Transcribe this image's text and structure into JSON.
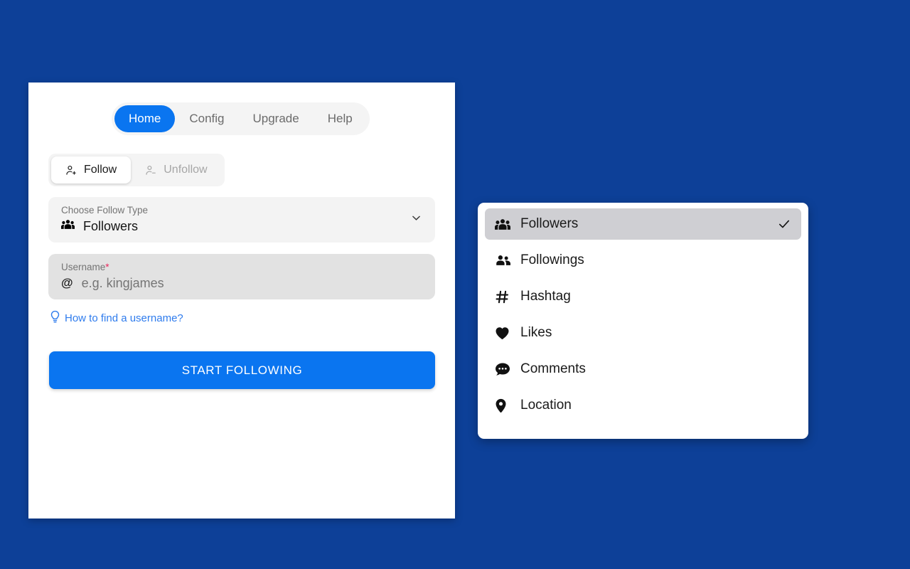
{
  "theme": {
    "background": "#0d4098",
    "accent": "#0a75f0",
    "panel": "#ffffff",
    "field_bg": "#f3f3f3",
    "field_bg_focus": "#e2e2e2",
    "selected_row": "#cfcfd3",
    "required_star": "#e8275c",
    "link": "#2f7ced"
  },
  "tabs": [
    {
      "label": "Home",
      "icon": "",
      "active": true
    },
    {
      "label": "Config",
      "icon": "",
      "active": false
    },
    {
      "label": "Upgrade",
      "icon": "",
      "active": false
    },
    {
      "label": "Help",
      "icon": "",
      "active": false
    }
  ],
  "mode_toggle": [
    {
      "label": "Follow",
      "icon": "person-plus-icon",
      "active": true
    },
    {
      "label": "Unfollow",
      "icon": "person-minus-icon",
      "active": false
    }
  ],
  "follow_type_field": {
    "label": "Choose Follow Type",
    "value": "Followers",
    "value_icon": "users-group-icon",
    "chevron_icon": "chevron-down-icon"
  },
  "username_field": {
    "label": "Username",
    "required_marker": "*",
    "prefix": "@",
    "value": "",
    "placeholder": "e.g. kingjames"
  },
  "hint": {
    "icon": "lightbulb-icon",
    "text": "How to find a username?"
  },
  "primary_action": {
    "label": "START FOLLOWING"
  },
  "dropdown": {
    "items": [
      {
        "label": "Followers",
        "icon": "users-group-icon",
        "selected": true,
        "check_icon": "check-icon"
      },
      {
        "label": "Followings",
        "icon": "users-icon",
        "selected": false,
        "check_icon": ""
      },
      {
        "label": "Hashtag",
        "icon": "hashtag-icon",
        "selected": false,
        "check_icon": ""
      },
      {
        "label": "Likes",
        "icon": "heart-icon",
        "selected": false,
        "check_icon": ""
      },
      {
        "label": "Comments",
        "icon": "comment-dots-icon",
        "selected": false,
        "check_icon": ""
      },
      {
        "label": "Location",
        "icon": "location-pin-icon",
        "selected": false,
        "check_icon": ""
      }
    ]
  }
}
